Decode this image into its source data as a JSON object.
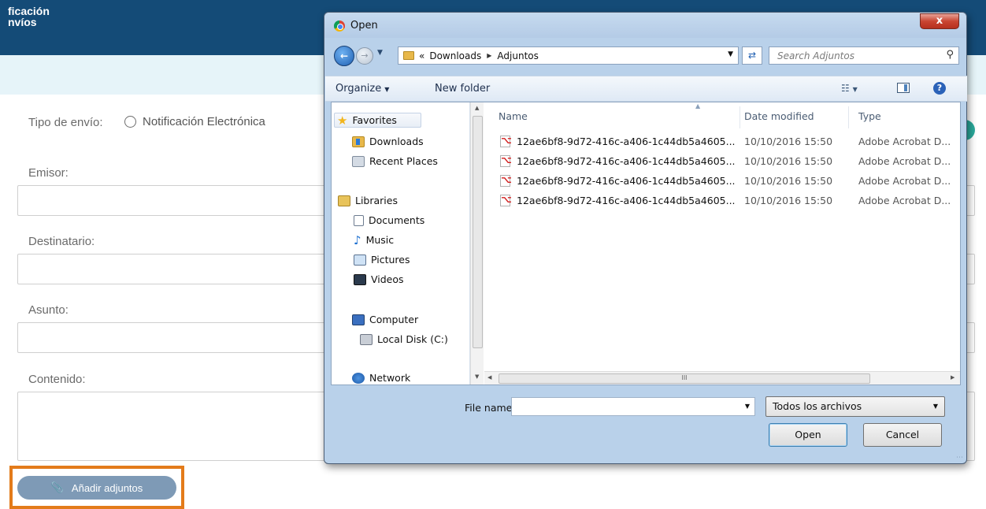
{
  "app": {
    "title": "ficación\nnvíos"
  },
  "form": {
    "tipo_label": "Tipo de envío:",
    "radio_label": "Notificación Electrónica",
    "emisor_label": "Emisor:",
    "destinatario_label": "Destinatario:",
    "asunto_label": "Asunto:",
    "contenido_label": "Contenido:",
    "attach_button": "Añadir adjuntos"
  },
  "dialog": {
    "title": "Open",
    "close_label": "x",
    "breadcrumb": [
      "«",
      "Downloads",
      "Adjuntos"
    ],
    "search_placeholder": "Search Adjuntos",
    "toolbar": {
      "organize": "Organize",
      "new_folder": "New folder"
    },
    "nav": {
      "favorites": "Favorites",
      "downloads": "Downloads",
      "recent_places": "Recent Places",
      "libraries": "Libraries",
      "documents": "Documents",
      "music": "Music",
      "pictures": "Pictures",
      "videos": "Videos",
      "computer": "Computer",
      "local_disk": "Local Disk (C:)",
      "network": "Network"
    },
    "columns": {
      "name": "Name",
      "date": "Date modified",
      "type": "Type"
    },
    "files": [
      {
        "name": "12ae6bf8-9d72-416c-a406-1c44db5a4605...",
        "date": "10/10/2016 15:50",
        "type": "Adobe Acrobat D..."
      },
      {
        "name": "12ae6bf8-9d72-416c-a406-1c44db5a4605...",
        "date": "10/10/2016 15:50",
        "type": "Adobe Acrobat D..."
      },
      {
        "name": "12ae6bf8-9d72-416c-a406-1c44db5a4605...",
        "date": "10/10/2016 15:50",
        "type": "Adobe Acrobat D..."
      },
      {
        "name": "12ae6bf8-9d72-416c-a406-1c44db5a4605...",
        "date": "10/10/2016 15:50",
        "type": "Adobe Acrobat D..."
      }
    ],
    "filename_label": "File name:",
    "filename_value": "",
    "filetype": "Todos los archivos",
    "open_button": "Open",
    "cancel_button": "Cancel"
  },
  "colors": {
    "header": "#144b77",
    "accent_orange": "#e37b1a",
    "attach_button": "#7e9ab6"
  }
}
